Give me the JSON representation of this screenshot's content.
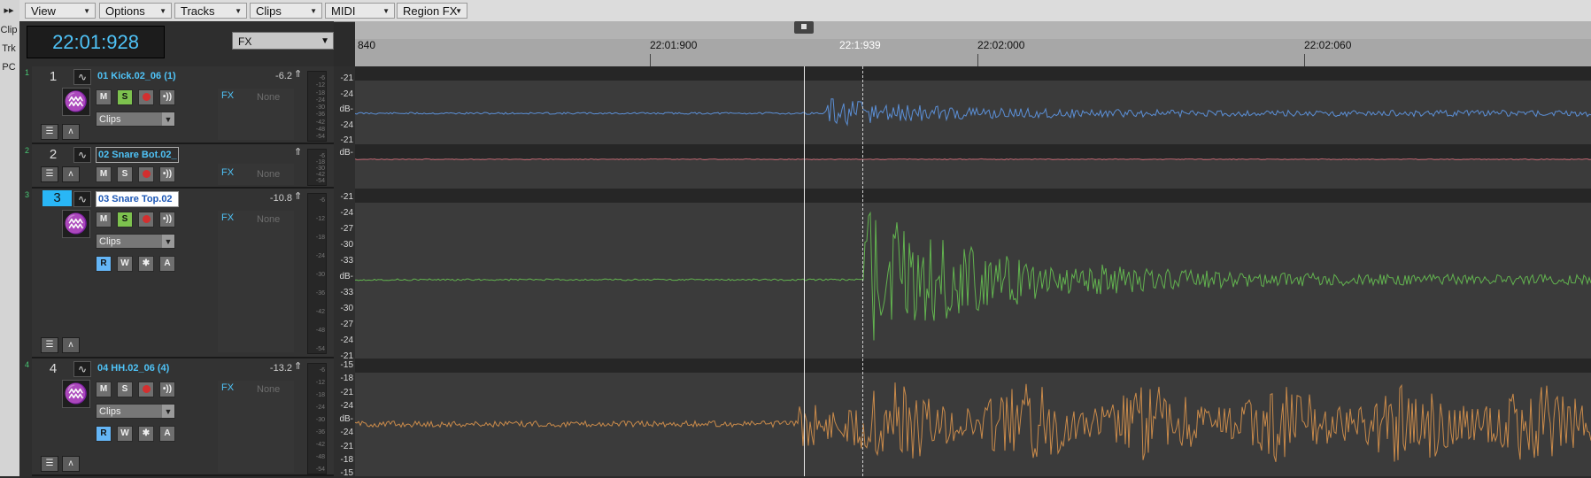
{
  "left_strip": {
    "top_arrow": "▸▸",
    "items": [
      "Clip",
      "Trk",
      "PC"
    ]
  },
  "menubar": {
    "items": [
      {
        "label": "View"
      },
      {
        "label": "Options"
      },
      {
        "label": "Tracks"
      },
      {
        "label": "Clips"
      },
      {
        "label": "MIDI"
      },
      {
        "label": "Region FX"
      }
    ]
  },
  "transport": {
    "time": "22:01:928"
  },
  "fx_selector": {
    "value": "FX"
  },
  "timeline": {
    "labels": [
      "840",
      "22:01:900",
      "22:02:000",
      "22:02:060"
    ],
    "now_label": "22:1:939"
  },
  "tracks": [
    {
      "number": "1",
      "name": "01 Kick.02_06 (1)",
      "volume": "-6.2",
      "solo_on": true,
      "clips_label": "Clips",
      "fx_label": "FX",
      "fx_value": "None",
      "color": "#5b8fd6"
    },
    {
      "number": "2",
      "name": "02 Snare Bot.02_",
      "volume": "",
      "solo_on": false,
      "clips_label": "",
      "fx_label": "FX",
      "fx_value": "None",
      "color": "#b8606b"
    },
    {
      "number": "3",
      "name": "03 Snare Top.02",
      "volume": "-10.8",
      "solo_on": true,
      "clips_label": "Clips",
      "fx_label": "FX",
      "fx_value": "None",
      "color": "#62b34f"
    },
    {
      "number": "4",
      "name": "04 HH.02_06 (4)",
      "volume": "-13.2",
      "solo_on": false,
      "clips_label": "Clips",
      "fx_label": "FX",
      "fx_value": "None",
      "color": "#c98a4a"
    }
  ],
  "button_labels": {
    "mute": "M",
    "solo": "S",
    "read": "R",
    "write": "W",
    "star": "✱",
    "auto": "A"
  },
  "db_scale": {
    "track1": [
      "-21",
      "-24",
      "dB-",
      "-24",
      "-21"
    ],
    "track2": [
      "dB-"
    ],
    "track3": [
      "-21",
      "-24",
      "-27",
      "-30",
      "-33",
      "dB-",
      "-33",
      "-30",
      "-27",
      "-24",
      "-21"
    ],
    "track4": [
      "-15",
      "-18",
      "-21",
      "-24",
      "dB-",
      "-24",
      "-21",
      "-18",
      "-15"
    ]
  },
  "meter_ticks": [
    "-6",
    "-12",
    "-18",
    "-24",
    "-30",
    "-36",
    "-42",
    "-48",
    "-54"
  ],
  "icons": {
    "wave": "wave-icon",
    "waveform_big": "waveform-icon",
    "arrow": "arrow-icon",
    "record": "record-icon",
    "input": "input-echo-icon"
  }
}
